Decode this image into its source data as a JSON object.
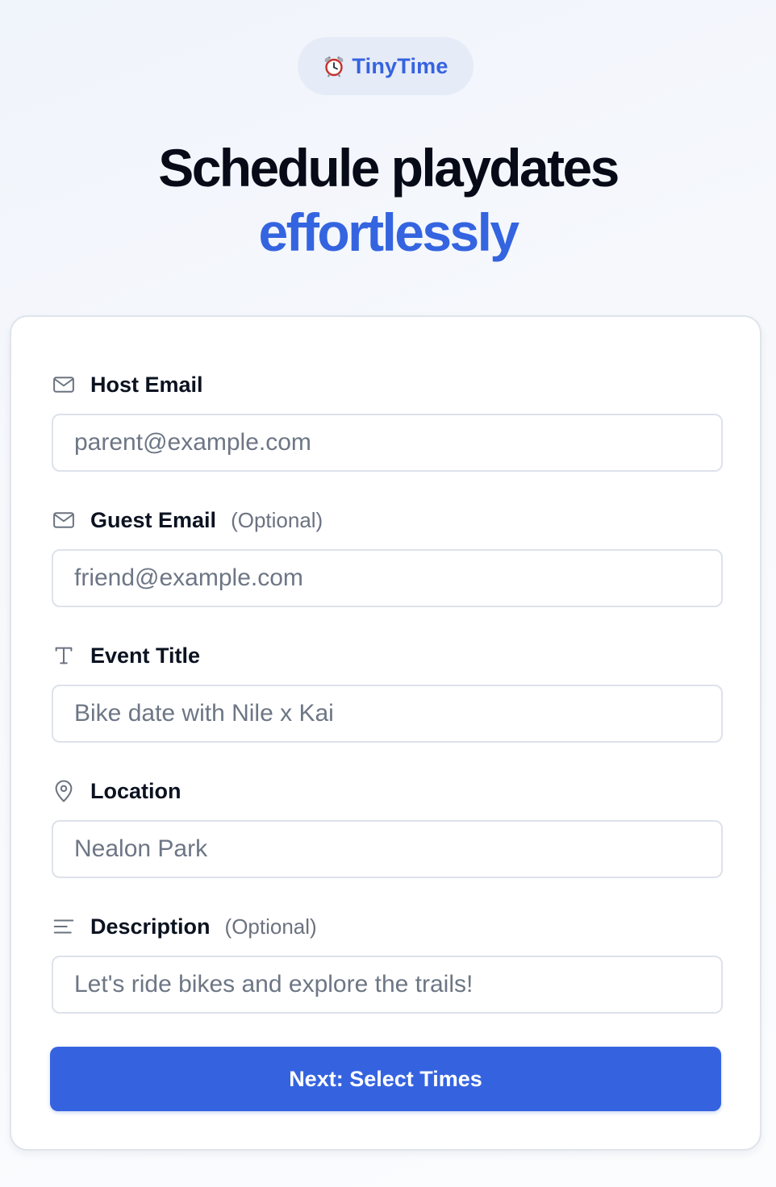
{
  "brand": {
    "name": "TinyTime",
    "icon": "alarm-clock-icon",
    "accent_color": "#3563e0"
  },
  "headline": {
    "line1": "Schedule playdates",
    "line2": "effortlessly"
  },
  "form": {
    "fields": [
      {
        "label": "Host Email",
        "optional_text": "",
        "placeholder": "parent@example.com",
        "icon": "mail-icon"
      },
      {
        "label": "Guest Email",
        "optional_text": "(Optional)",
        "placeholder": "friend@example.com",
        "icon": "mail-icon"
      },
      {
        "label": "Event Title",
        "optional_text": "",
        "placeholder": "Bike date with Nile x Kai",
        "icon": "text-type-icon"
      },
      {
        "label": "Location",
        "optional_text": "",
        "placeholder": "Nealon Park",
        "icon": "map-pin-icon"
      },
      {
        "label": "Description",
        "optional_text": "(Optional)",
        "placeholder": "Let's ride bikes and explore the trails!",
        "icon": "align-left-icon"
      }
    ],
    "submit_label": "Next: Select Times",
    "button_color": "#3563e0"
  }
}
